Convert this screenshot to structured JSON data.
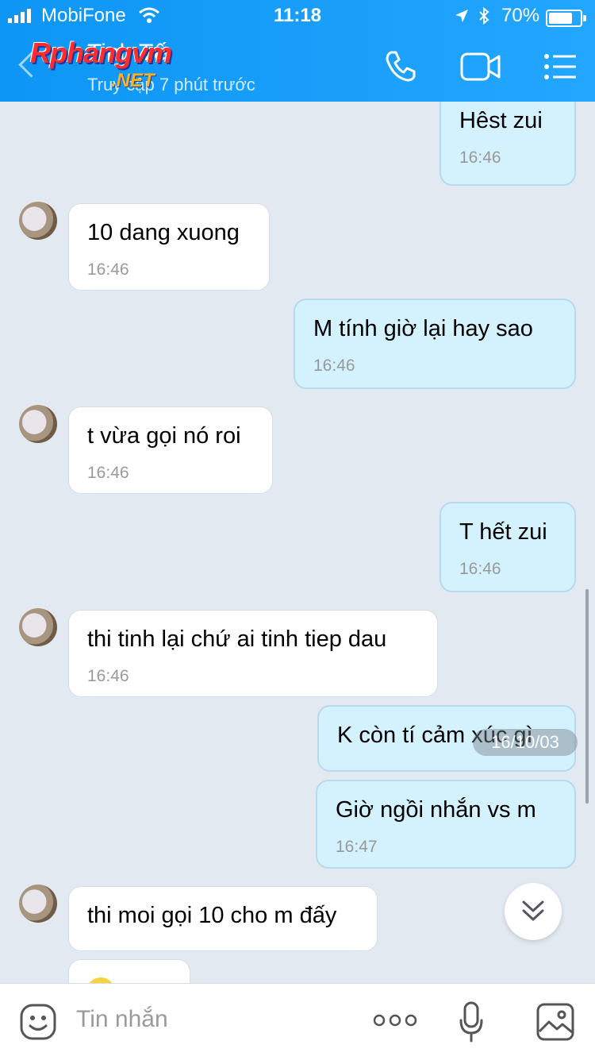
{
  "status_bar": {
    "carrier": "MobiFone",
    "time": "11:18",
    "battery": "70%"
  },
  "header": {
    "title": "Tinh Tế",
    "subtitle": "Truy cập 7 phút trước",
    "watermark": "Rphangvm",
    "watermark_net": ".NET"
  },
  "messages": [
    {
      "dir": "out",
      "text": "Hêst zui",
      "time": "16:46"
    },
    {
      "dir": "in",
      "text": "10 dang xuong",
      "time": "16:46"
    },
    {
      "dir": "out",
      "text": "M tính giờ lại hay sao",
      "time": "16:46"
    },
    {
      "dir": "in",
      "text": "t vừa gọi nó roi",
      "time": "16:46"
    },
    {
      "dir": "out",
      "text": "T hết zui",
      "time": "16:46"
    },
    {
      "dir": "in",
      "text": "thi tinh lại chứ ai tinh tiep dau",
      "time": "16:46"
    },
    {
      "dir": "out",
      "text": "K còn tí cảm xúc gì",
      "time": ""
    },
    {
      "dir": "out",
      "text": "Giờ ngồi nhắn vs m",
      "time": "16:47"
    },
    {
      "dir": "in",
      "text": "thi moi gọi 10 cho m đấy",
      "time": ""
    }
  ],
  "date_overlay": "16/10/03",
  "composer": {
    "placeholder": "Tin nhắn"
  },
  "colors": {
    "header": "#1aa0fb",
    "bubble_out": "#d4f1fe",
    "bubble_in": "#ffffff",
    "chat_bg": "#e2e9f1"
  }
}
